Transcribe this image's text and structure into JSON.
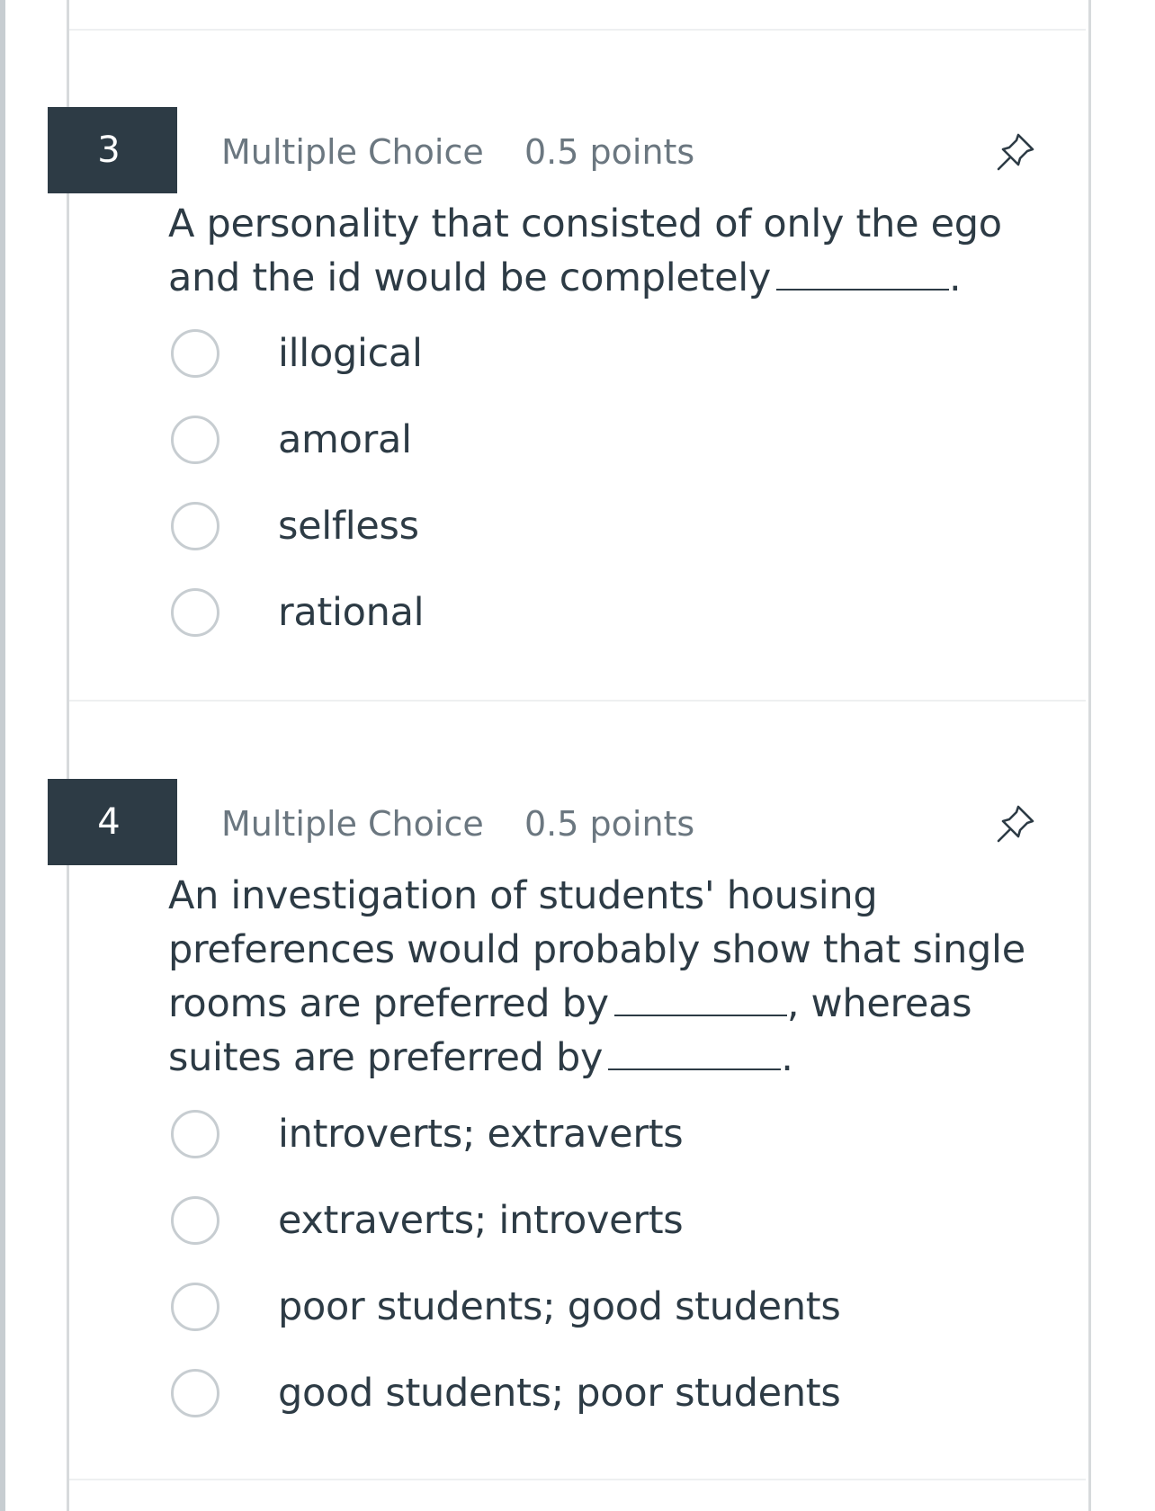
{
  "questions": [
    {
      "number": "3",
      "type": "Multiple Choice",
      "points": "0.5 points",
      "text_line1": "A personality that consisted of only the ego",
      "text_line2_pre": "and the id would be completely",
      "text_line2_post": ".",
      "options": [
        {
          "label": "illogical"
        },
        {
          "label": "amoral"
        },
        {
          "label": "selfless"
        },
        {
          "label": "rational"
        }
      ]
    },
    {
      "number": "4",
      "type": "Multiple Choice",
      "points": "0.5 points",
      "text_line1": "An investigation of students' housing",
      "text_line2": "preferences would probably show that single",
      "text_line3_pre": "rooms are preferred by",
      "text_line3_post": ", whereas",
      "text_line4_pre": "suites are preferred by",
      "text_line4_post": ".",
      "options": [
        {
          "label": "introverts; extraverts"
        },
        {
          "label": "extraverts; introverts"
        },
        {
          "label": "poor students; good students"
        },
        {
          "label": "good students; poor students"
        }
      ]
    }
  ],
  "icons": {
    "pin": "pushpin-icon"
  },
  "colors": {
    "question_number_bg": "#2d3b45",
    "text": "#2d3b45",
    "meta_text": "#6b7780",
    "radio_border": "#c7cdd1"
  }
}
